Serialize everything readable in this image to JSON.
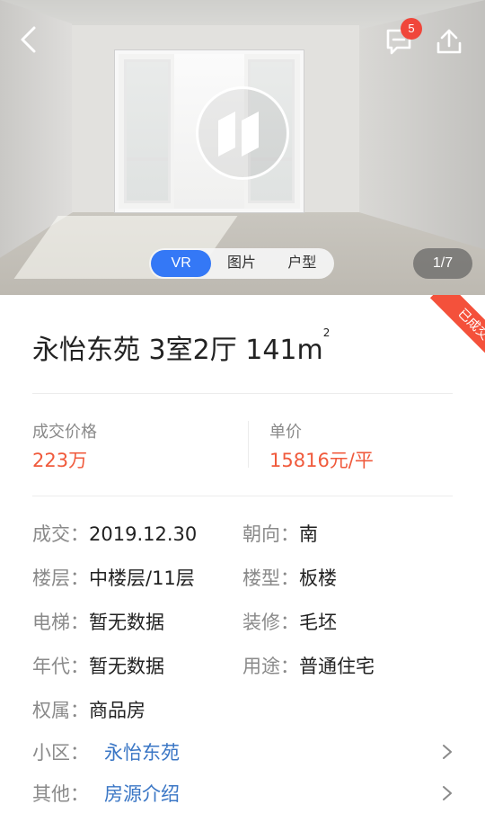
{
  "header": {
    "message_badge": "5"
  },
  "media": {
    "tabs": [
      {
        "label": "VR",
        "active": true
      },
      {
        "label": "图片",
        "active": false
      },
      {
        "label": "户型",
        "active": false
      }
    ],
    "counter": "1/7"
  },
  "status_ribbon": "已成交",
  "listing": {
    "title": "永怡东苑 3室2厅 141m",
    "title_sup": "2"
  },
  "price": {
    "deal_label": "成交价格",
    "deal_value": "223万",
    "unit_label": "单价",
    "unit_value": "15816元/平"
  },
  "details": {
    "deal_date_key": "成交：",
    "deal_date": "2019.12.30",
    "orientation_key": "朝向：",
    "orientation": "南",
    "floor_key": "楼层：",
    "floor": "中楼层/11层",
    "building_type_key": "楼型：",
    "building_type": "板楼",
    "elevator_key": "电梯：",
    "elevator": "暂无数据",
    "decoration_key": "装修：",
    "decoration": "毛坯",
    "year_key": "年代：",
    "year": "暂无数据",
    "usage_key": "用途：",
    "usage": "普通住宅",
    "ownership_key": "权属：",
    "ownership": "商品房"
  },
  "links": {
    "community_key": "小区：",
    "community": "永怡东苑",
    "other_key": "其他：",
    "other": "房源介绍"
  },
  "colors": {
    "accent_blue": "#3478f6",
    "link_blue": "#3a76c5",
    "price_red": "#f05a3c",
    "ribbon_red": "#f4513b",
    "label_gray": "#8a8a8a"
  },
  "icons": {
    "back": "back-arrow-icon",
    "message": "message-icon",
    "share": "share-icon",
    "vr": "vr-icon",
    "chevron": "chevron-right-icon"
  }
}
